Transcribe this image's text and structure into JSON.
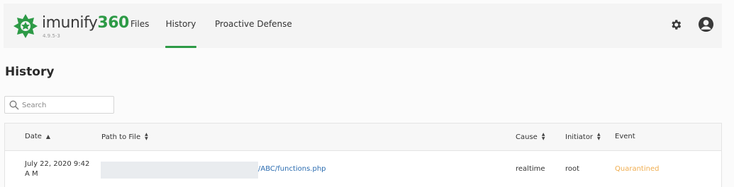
{
  "brand": {
    "name": "imunify",
    "number": "360",
    "version": "4.9.5-3"
  },
  "nav": {
    "items": [
      {
        "label": "Files"
      },
      {
        "label": "History",
        "active": true
      },
      {
        "label": "Proactive Defense"
      }
    ]
  },
  "icons": {
    "settings": "gear-icon",
    "user": "user-avatar-icon",
    "search": "search-icon"
  },
  "page": {
    "title": "History"
  },
  "search": {
    "placeholder": "Search",
    "value": ""
  },
  "table": {
    "columns": [
      {
        "label": "Date",
        "sort": "asc"
      },
      {
        "label": "Path to File",
        "sort": "none"
      },
      {
        "label": "Cause",
        "sort": "none"
      },
      {
        "label": "Initiator",
        "sort": "none"
      },
      {
        "label": "Event"
      }
    ],
    "rows": [
      {
        "date": "July 22, 2020 9:42 A M",
        "path": "/ABC/functions.php",
        "cause": "realtime",
        "initiator": "root",
        "event": "Quarantined"
      }
    ]
  },
  "colors": {
    "brand_green": "#2d9a46",
    "link": "#2b6cb0",
    "event_warning": "#f0ad4e"
  }
}
